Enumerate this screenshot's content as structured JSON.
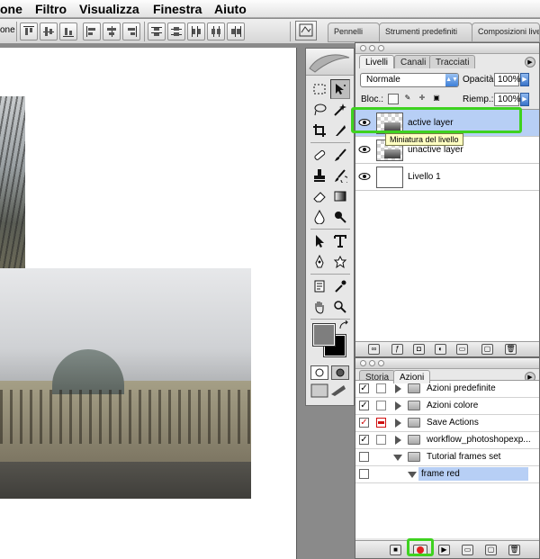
{
  "menubar": {
    "items": [
      {
        "label": "one"
      },
      {
        "label": "Filtro"
      },
      {
        "label": "Visualizza"
      },
      {
        "label": "Finestra"
      },
      {
        "label": "Aiuto"
      }
    ]
  },
  "options_bar": {
    "left_label": "one",
    "well_tabs": [
      {
        "label": "Pennelli"
      },
      {
        "label": "Strumenti predefiniti"
      },
      {
        "label": "Composizioni live"
      }
    ]
  },
  "layers_palette": {
    "tabs": [
      {
        "label": "Livelli"
      },
      {
        "label": "Canali"
      },
      {
        "label": "Tracciati"
      }
    ],
    "blend_mode": "Normale",
    "opacity_label": "Opacità:",
    "opacity_value": "100%",
    "lock_label": "Bloc.:",
    "fill_label": "Riemp.:",
    "fill_value": "100%",
    "tooltip": "Miniatura del livello",
    "layers": [
      {
        "name": "active layer",
        "visible": true,
        "selected": true
      },
      {
        "name": "unactive layer",
        "visible": true,
        "selected": false
      },
      {
        "name": "Livello 1",
        "visible": true,
        "selected": false
      }
    ]
  },
  "actions_palette": {
    "tabs": [
      {
        "label": "Storia"
      },
      {
        "label": "Azioni"
      }
    ],
    "items": [
      {
        "name": "Azioni predefinite",
        "checked": true,
        "level": 0
      },
      {
        "name": "Azioni colore",
        "checked": true,
        "level": 0
      },
      {
        "name": "Save Actions",
        "checked": true,
        "level": 0
      },
      {
        "name": "workflow_photoshopexp...",
        "checked": true,
        "level": 0
      },
      {
        "name": "Tutorial frames set",
        "checked": false,
        "level": 0
      },
      {
        "name": "frame red",
        "checked": false,
        "level": 1
      }
    ]
  },
  "colors": {
    "highlight": "#3ed21f",
    "selection": "#b7cff5",
    "record": "#e02020",
    "foreground": "#7e7e7e",
    "background": "#000000"
  }
}
